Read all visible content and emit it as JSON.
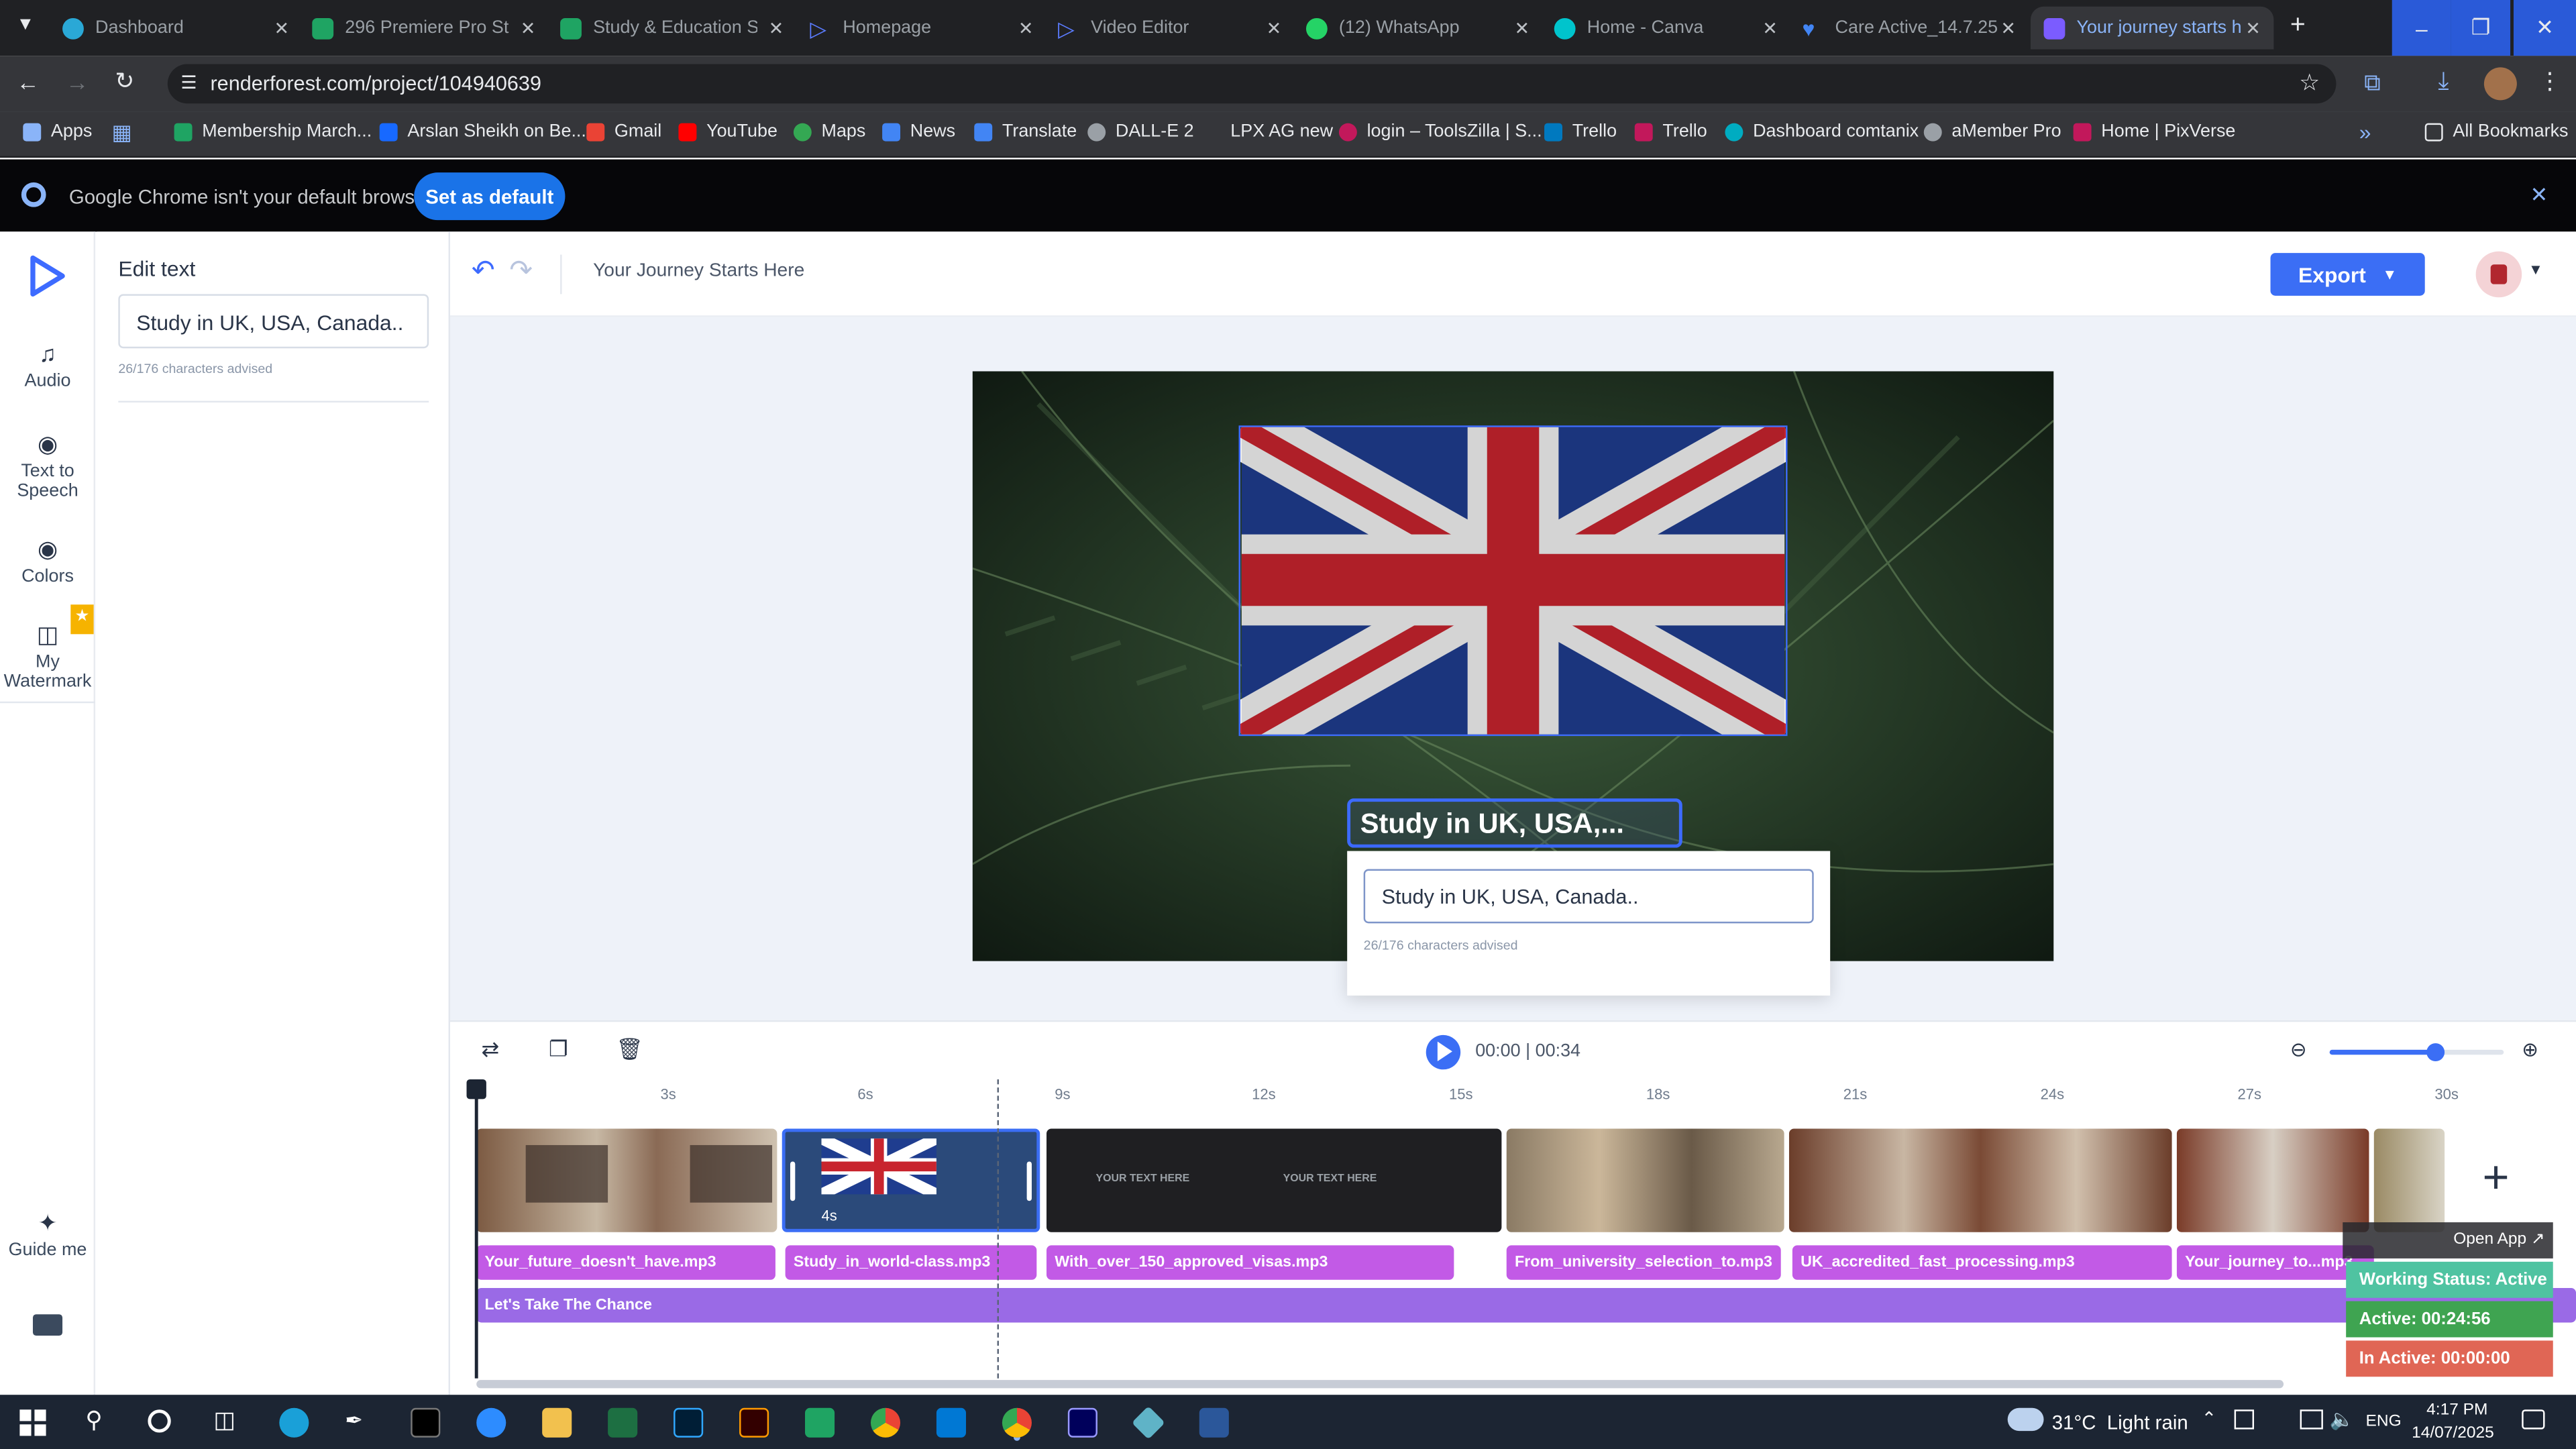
{
  "browser": {
    "tabs": [
      {
        "title": "Dashboard",
        "color": "#2aa8d6"
      },
      {
        "title": "296 Premiere Pro Stu",
        "color": "#1fa463"
      },
      {
        "title": "Study & Education Sl",
        "color": "#1fa463"
      },
      {
        "title": "Homepage",
        "color": "#5b7cff"
      },
      {
        "title": "Video Editor",
        "color": "#5b7cff"
      },
      {
        "title": "(12) WhatsApp",
        "color": "#25d366"
      },
      {
        "title": "Home - Canva",
        "color": "#00c4cc"
      },
      {
        "title": "Care Active_14.7.25 (",
        "color": "#4285f4"
      },
      {
        "title": "Your journey starts h",
        "color": "#7b5cff"
      }
    ],
    "url": "renderforest.com/project/104940639",
    "bookmarks": [
      {
        "label": "Apps"
      },
      {
        "label": "Membership March..."
      },
      {
        "label": "Arslan Sheikh on Be..."
      },
      {
        "label": "Gmail"
      },
      {
        "label": "YouTube"
      },
      {
        "label": "Maps"
      },
      {
        "label": "News"
      },
      {
        "label": "Translate"
      },
      {
        "label": "DALL-E 2"
      },
      {
        "label": "LPX AG new"
      },
      {
        "label": "login – ToolsZilla | S..."
      },
      {
        "label": "Trello"
      },
      {
        "label": "Trello"
      },
      {
        "label": "Dashboard comtanix"
      },
      {
        "label": "aMember Pro"
      },
      {
        "label": "Home | PixVerse"
      }
    ],
    "all_bookmarks": "All Bookmarks",
    "notice_text": "Google Chrome isn't your default browser",
    "set_default": "Set as default"
  },
  "editor": {
    "nav": {
      "audio": "Audio",
      "tts_line1": "Text to",
      "tts_line2": "Speech",
      "colors": "Colors",
      "wm_line1": "My",
      "wm_line2": "Watermark",
      "guide": "Guide me"
    },
    "panel": {
      "title": "Edit text",
      "value": "Study in UK, USA, Canada..",
      "chars": "26/176",
      "chars_note": "characters advised"
    },
    "project_title": "Your Journey Starts Here",
    "export_label": "Export",
    "canvas": {
      "headline": "Study in UK, USA,...",
      "popup_value": "Study in UK, USA, Canada..",
      "popup_chars": "26/176",
      "popup_note": "characters advised"
    },
    "timeline": {
      "time_current": "00:00",
      "time_total": "00:34",
      "ticks": [
        "3s",
        "6s",
        "9s",
        "12s",
        "15s",
        "18s",
        "21s",
        "24s",
        "27s",
        "30s"
      ],
      "selected_duration": "4s",
      "placeholder_text": "YOUR TEXT HERE",
      "audio_clips": [
        "Your_future_doesn't_have.mp3",
        "Study_in_world-class.mp3",
        "With_over_150_approved_visas.mp3",
        "From_university_selection_to.mp3",
        "UK_accredited_fast_processing.mp3",
        "Your_journey_to...mp3"
      ],
      "music": "Let's Take The Chance",
      "zoom_level": 0.6
    }
  },
  "overlay": {
    "open_app": "Open App",
    "working": "Working Status: Active",
    "active": "Active: 00:24:56",
    "inactive": "In Active: 00:00:00"
  },
  "system": {
    "weather": "31°C  Light rain",
    "lang": "ENG",
    "time": "4:17 PM",
    "date": "14/07/2025"
  }
}
